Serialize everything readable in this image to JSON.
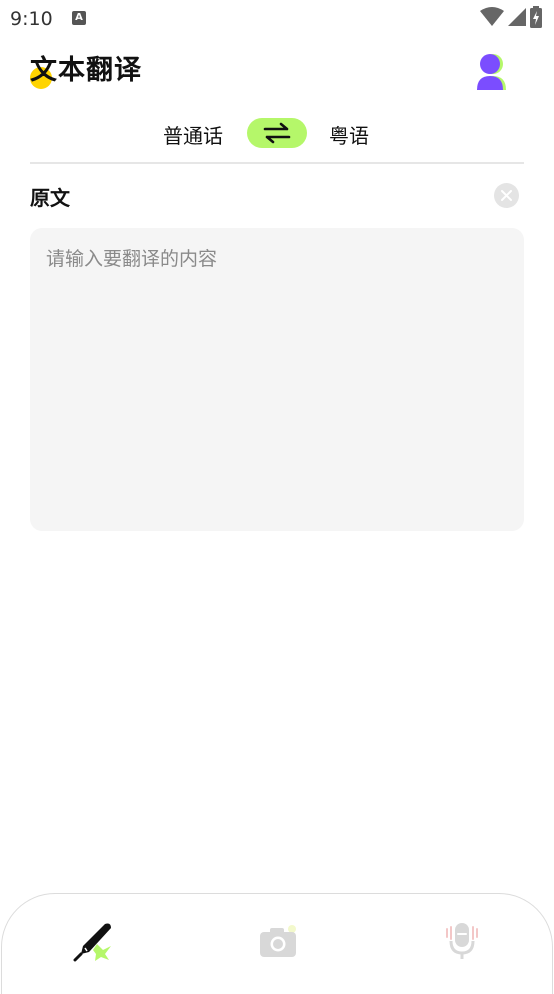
{
  "status_bar": {
    "time": "9:10",
    "notification_glyph": "A"
  },
  "header": {
    "title": "文本翻译",
    "avatar_icon": "user-avatar-icon"
  },
  "language": {
    "source": "普通话",
    "target": "粤语",
    "swap_icon": "swap-arrows-icon"
  },
  "source_section": {
    "label": "原文",
    "clear_icon": "clear-icon"
  },
  "input": {
    "placeholder": "请输入要翻译的内容",
    "value": ""
  },
  "bottom_nav": {
    "items": [
      {
        "id": "text",
        "icon": "pen-icon",
        "active": true
      },
      {
        "id": "camera",
        "icon": "camera-icon",
        "active": false
      },
      {
        "id": "voice",
        "icon": "microphone-icon",
        "active": false
      }
    ]
  },
  "colors": {
    "accent": "#b5f76a",
    "title_dot": "#ffd400",
    "avatar": "#7b4dff",
    "input_bg": "#f5f5f5"
  }
}
